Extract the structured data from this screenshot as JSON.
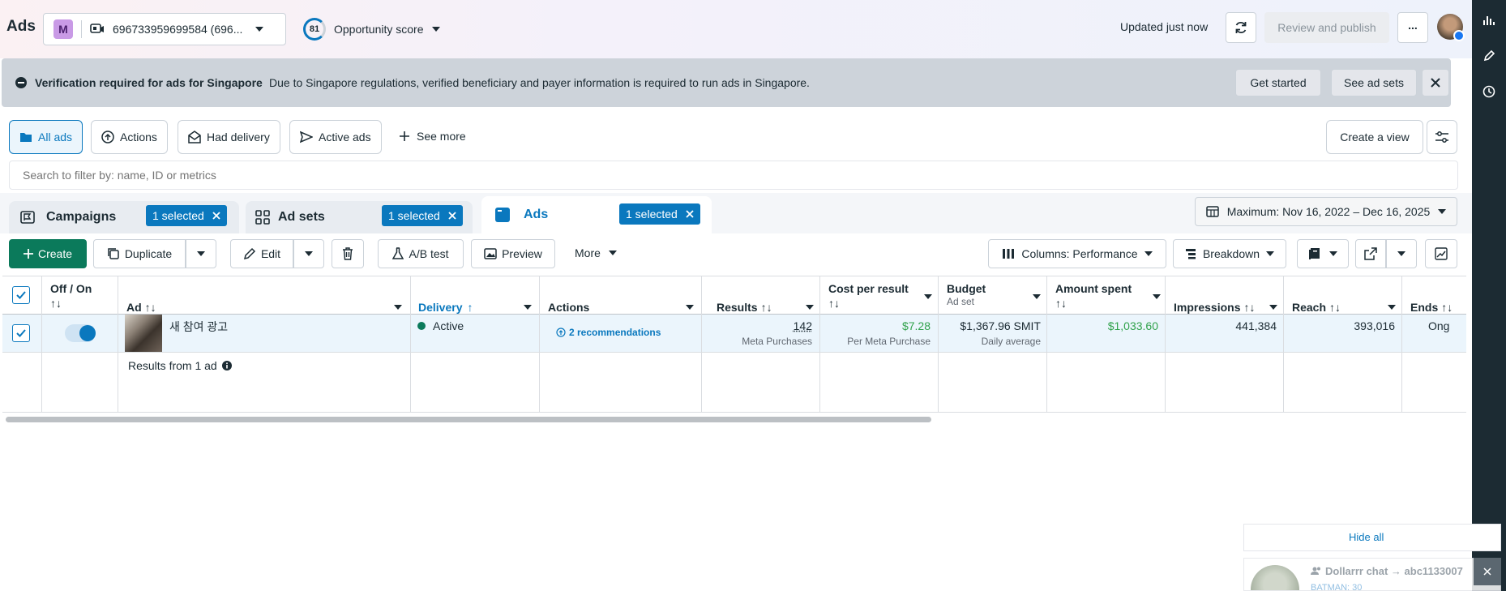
{
  "header": {
    "title": "Ads",
    "account_initial": "M",
    "account_id": "696733959699584 (696...",
    "opportunity_score": "81",
    "opportunity_label": "Opportunity score",
    "updated_text": "Updated just now",
    "review_publish_label": "Review and publish",
    "more_label": "..."
  },
  "banner": {
    "title": "Verification required for ads for Singapore",
    "message": "Due to Singapore regulations, verified beneficiary and payer information is required to run ads in Singapore.",
    "get_started_label": "Get started",
    "see_ad_sets_label": "See ad sets"
  },
  "views": {
    "all_ads": "All ads",
    "actions": "Actions",
    "had_delivery": "Had delivery",
    "active_ads": "Active ads",
    "see_more": "See more",
    "create_view": "Create a view"
  },
  "search": {
    "placeholder": "Search to filter by: name, ID or metrics"
  },
  "levels": {
    "campaigns": "Campaigns",
    "campaigns_badge": "1 selected",
    "ad_sets": "Ad sets",
    "ad_sets_badge": "1 selected",
    "ads": "Ads",
    "ads_badge": "1 selected"
  },
  "date_range": "Maximum: Nov 16, 2022 – Dec 16, 2025",
  "toolbar": {
    "create": "Create",
    "duplicate": "Duplicate",
    "edit": "Edit",
    "ab_test": "A/B test",
    "preview": "Preview",
    "more": "More",
    "columns": "Columns: Performance",
    "breakdown": "Breakdown"
  },
  "table": {
    "headers": {
      "off_on": "Off / On",
      "ad": "Ad",
      "delivery": "Delivery",
      "actions": "Actions",
      "results": "Results",
      "cost_per_result": "Cost per result",
      "budget": "Budget",
      "budget_sub": "Ad set",
      "amount_spent": "Amount spent",
      "impressions": "Impressions",
      "reach": "Reach",
      "ends": "Ends"
    },
    "row": {
      "ad_name": "새 참여 광고",
      "delivery": "Active",
      "recommendations": "2 recommendations",
      "results": "142",
      "results_sub": "Meta Purchases",
      "cost_per_result": "$7.28",
      "cost_sub": "Per Meta Purchase",
      "budget": "$1,367.96 SMIT",
      "budget_sub": "Daily average",
      "amount_spent": "$1,033.60",
      "impressions": "441,384",
      "reach": "393,016",
      "ends": "Ong"
    },
    "summary": "Results from 1 ad"
  },
  "chat": {
    "hide_all": "Hide all",
    "title": "Dollarrr chat → abc1133007",
    "sender": "BATMAN: 30"
  },
  "colors": {
    "accent": "#0a78be",
    "green": "#31a24c",
    "delivery_dot": "#0b7a5b",
    "rail": "#1c2b33"
  }
}
